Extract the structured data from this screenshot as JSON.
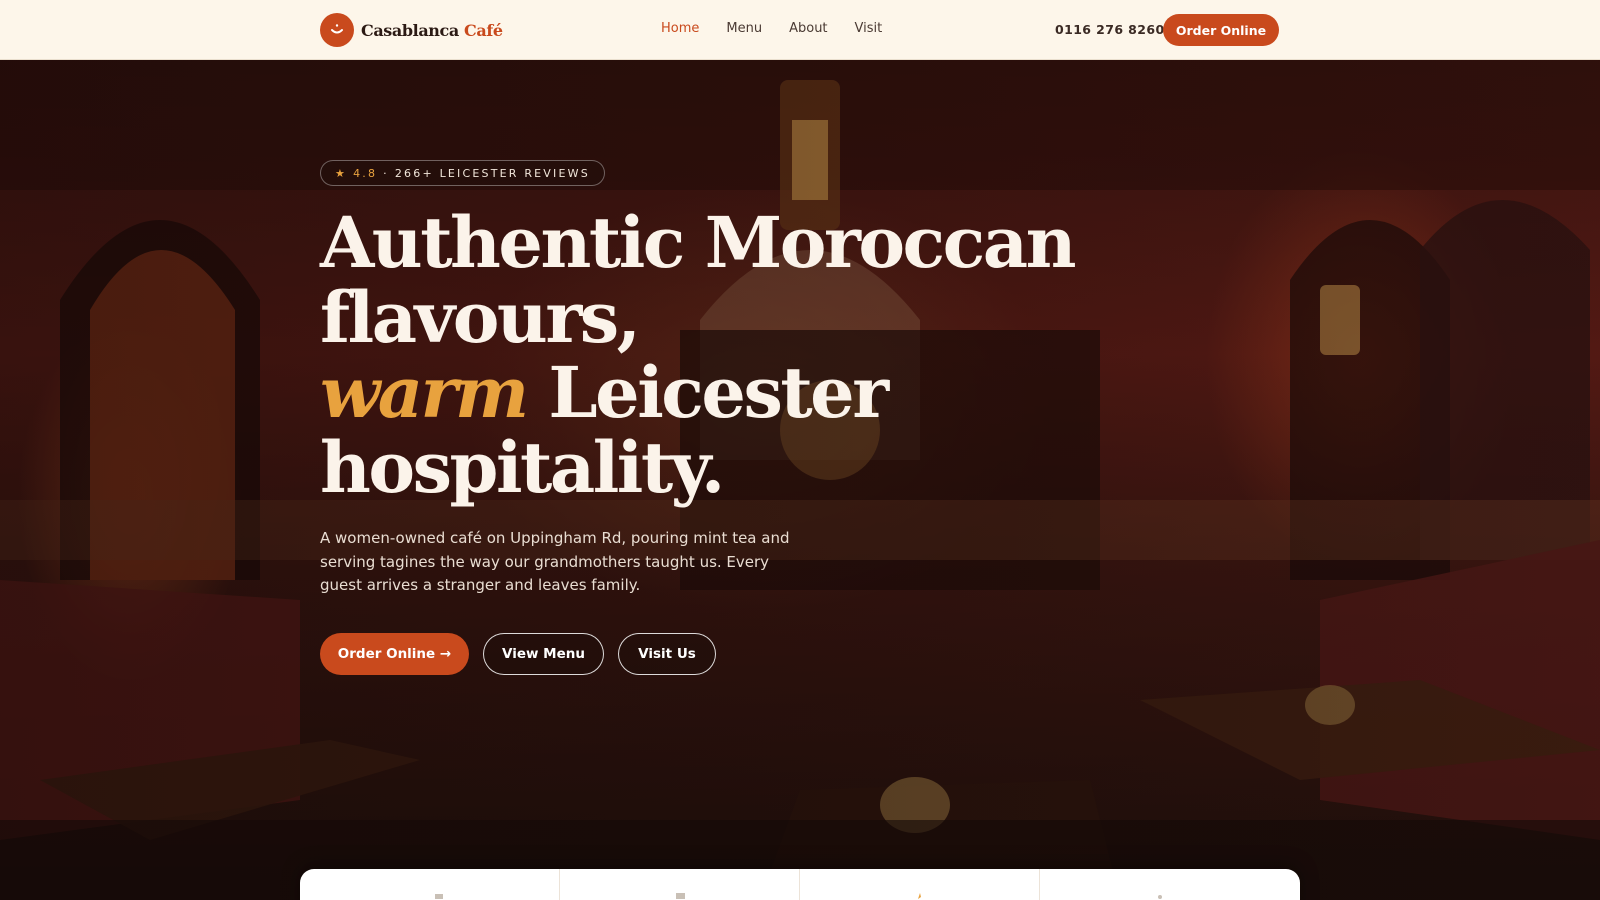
{
  "header": {
    "logo_name": "Casablanca",
    "logo_accent": "Café",
    "nav": [
      "Home",
      "Menu",
      "About",
      "Visit"
    ],
    "active_nav": "Home",
    "phone": "0116 276 8260",
    "order_label": "Order Online"
  },
  "hero": {
    "badge": {
      "star": "★",
      "rating": "4.8",
      "separator": "·",
      "reviews": "266+ LEICESTER REVIEWS"
    },
    "headline": {
      "line1": "Authentic Moroccan",
      "line2": "flavours,",
      "line3_emphasis": "warm",
      "line3_rest": " Leicester",
      "line4": "hospitality."
    },
    "subtitle": "A women-owned café on Uppingham Rd, pouring mint tea and serving tagines the way our grandmothers taught us. Every guest arrives a stranger and leaves family.",
    "buttons": {
      "order": "Order Online →",
      "menu": "View Menu",
      "visit": "Visit Us"
    }
  },
  "colors": {
    "accent": "#c94a1d",
    "gold": "#e8a23e",
    "header_bg": "#fdf6ea"
  },
  "icons": [
    "smile-logo-icon",
    "star-icon"
  ]
}
